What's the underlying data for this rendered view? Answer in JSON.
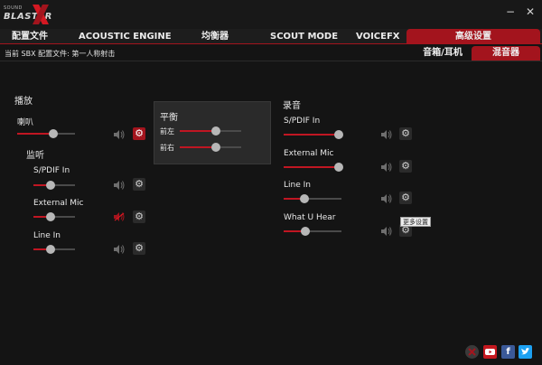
{
  "app": {
    "logo_small": "SOUND",
    "logo_text": "BLASTER",
    "window_controls": {
      "minimize": "−",
      "close": "✕"
    }
  },
  "tabs": [
    "配置文件",
    "ACOUSTIC ENGINE",
    "均衡器",
    "SCOUT MODE",
    "VOICEFX",
    "高级设置"
  ],
  "profile_line": "当前 SBX 配置文件: 第一人称射击",
  "sub_tabs": [
    "音箱/耳机",
    "混音器"
  ],
  "playback": {
    "heading": "播放",
    "speaker": {
      "label": "喇叭",
      "level": 0.62,
      "muted": false
    },
    "monitor": {
      "heading": "监听",
      "items": [
        {
          "label": "S/PDIF In",
          "level": 0.42,
          "muted": false
        },
        {
          "label": "External Mic",
          "level": 0.42,
          "muted": true
        },
        {
          "label": "Line In",
          "level": 0.42,
          "muted": false
        }
      ]
    }
  },
  "balance": {
    "heading": "平衡",
    "items": [
      {
        "label": "前左",
        "level": 0.59
      },
      {
        "label": "前右",
        "level": 0.59
      }
    ]
  },
  "recording": {
    "heading": "录音",
    "items": [
      {
        "label": "S/PDIF In",
        "level": 0.96,
        "muted": false
      },
      {
        "label": "External Mic",
        "level": 0.96,
        "muted": false
      },
      {
        "label": "Line In",
        "level": 0.36,
        "muted": false
      },
      {
        "label": "What U Hear",
        "level": 0.38,
        "muted": false
      }
    ]
  },
  "tooltip": "更多设置",
  "social": [
    "youtube",
    "facebook",
    "twitter"
  ],
  "colors": {
    "accent": "#a3141d",
    "background": "#141414",
    "panel": "#2a2a2a"
  }
}
